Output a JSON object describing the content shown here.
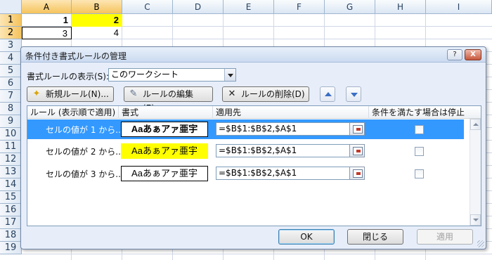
{
  "sheet": {
    "columns": [
      "A",
      "B",
      "C",
      "D",
      "E",
      "F",
      "G",
      "H",
      "I"
    ],
    "rows": [
      "1",
      "2",
      "3",
      "4",
      "5",
      "6",
      "7",
      "8",
      "9",
      "10",
      "11",
      "12",
      "13",
      "14",
      "15",
      "16",
      "17",
      "18",
      "19"
    ],
    "cells": {
      "A1": "1",
      "B1": "2",
      "A2": "3",
      "B2": "4"
    },
    "colors": {
      "highlight": "#ffff00"
    }
  },
  "dialog": {
    "title": "条件付き書式ルールの管理",
    "help_btn": "?",
    "close_btn": "X",
    "show_rules_label": "書式ルールの表示(S):",
    "show_rules_value": "このワークシート",
    "new_rule": "新規ルール(N)...",
    "edit_rule": "ルールの編集(E)...",
    "delete_rule": "ルールの削除(D)",
    "columns": {
      "rule": "ルール (表示順で適用)",
      "format": "書式",
      "applies_to": "適用先",
      "stop_if_true": "条件を満たす場合は停止"
    },
    "rules": [
      {
        "name": "セルの値が 1 から...",
        "format_preview": "Aaあぁアァ亜宇",
        "applies_to": "=$B$1:$B$2,$A$1",
        "selected": true,
        "style": "bold"
      },
      {
        "name": "セルの値が 2 から...",
        "format_preview": "Aaあぁアァ亜宇",
        "applies_to": "=$B$1:$B$2,$A$1",
        "selected": false,
        "style": "yellow"
      },
      {
        "name": "セルの値が 3 から...",
        "format_preview": "Aaあぁアァ亜宇",
        "applies_to": "=$B$1:$B$2,$A$1",
        "selected": false,
        "style": "plain"
      }
    ],
    "ok": "OK",
    "close": "閉じる",
    "apply": "適用",
    "colors": {
      "selection": "#3399ff",
      "dialog_bg": "#e7eefa"
    }
  }
}
